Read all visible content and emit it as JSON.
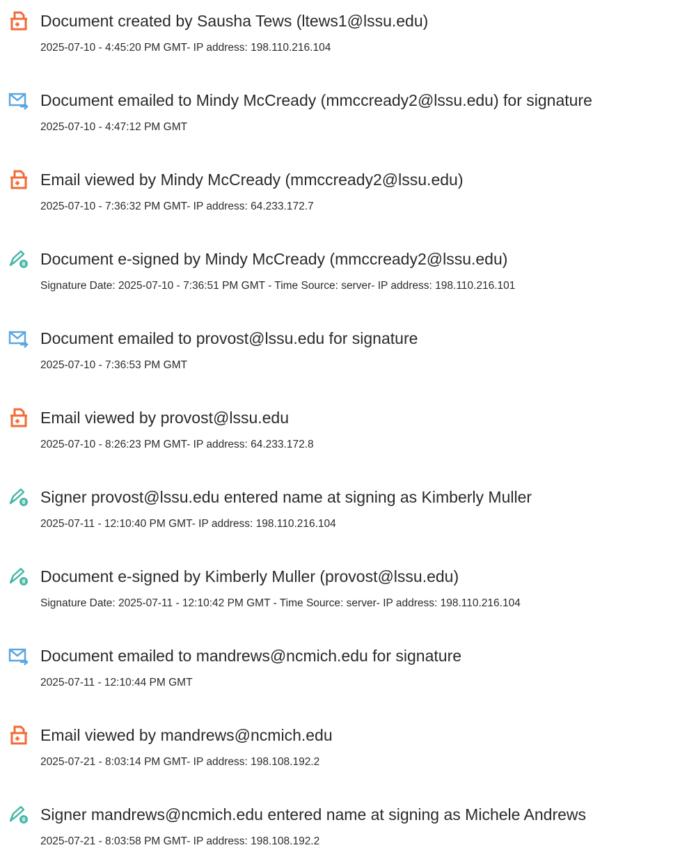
{
  "events": [
    {
      "icon": "document-created-icon",
      "title": "Document created by Sausha Tews (ltews1@lssu.edu)",
      "detail": "2025-07-10 - 4:45:20 PM GMT- IP address: 198.110.216.104"
    },
    {
      "icon": "document-emailed-icon",
      "title": "Document emailed to Mindy McCready (mmccready2@lssu.edu) for signature",
      "detail": "2025-07-10 - 4:47:12 PM GMT"
    },
    {
      "icon": "email-viewed-icon",
      "title": "Email viewed by Mindy McCready (mmccready2@lssu.edu)",
      "detail": "2025-07-10 - 7:36:32 PM GMT- IP address: 64.233.172.7"
    },
    {
      "icon": "e-signature-pen-icon",
      "title": "Document e-signed by Mindy McCready (mmccready2@lssu.edu)",
      "detail": "Signature Date: 2025-07-10 - 7:36:51 PM GMT - Time Source: server- IP address: 198.110.216.101"
    },
    {
      "icon": "document-emailed-icon",
      "title": "Document emailed to provost@lssu.edu for signature",
      "detail": "2025-07-10 - 7:36:53 PM GMT"
    },
    {
      "icon": "email-viewed-icon",
      "title": "Email viewed by provost@lssu.edu",
      "detail": "2025-07-10 - 8:26:23 PM GMT- IP address: 64.233.172.8"
    },
    {
      "icon": "e-signature-pen-icon",
      "title": "Signer provost@lssu.edu entered name at signing as Kimberly Muller",
      "detail": "2025-07-11 - 12:10:40 PM GMT- IP address: 198.110.216.104"
    },
    {
      "icon": "e-signature-pen-icon",
      "title": "Document e-signed by Kimberly Muller (provost@lssu.edu)",
      "detail": "Signature Date: 2025-07-11 - 12:10:42 PM GMT - Time Source: server- IP address: 198.110.216.104"
    },
    {
      "icon": "document-emailed-icon",
      "title": "Document emailed to mandrews@ncmich.edu for signature",
      "detail": "2025-07-11 - 12:10:44 PM GMT"
    },
    {
      "icon": "email-viewed-icon",
      "title": "Email viewed by mandrews@ncmich.edu",
      "detail": "2025-07-21 - 8:03:14 PM GMT- IP address: 198.108.192.2"
    },
    {
      "icon": "e-signature-pen-icon",
      "title": "Signer mandrews@ncmich.edu entered name at signing as Michele Andrews",
      "detail": "2025-07-21 - 8:03:58 PM GMT- IP address: 198.108.192.2"
    }
  ],
  "colors": {
    "document_icon": "#f26a37",
    "email_icon": "#5ba7e0",
    "pen_icon": "#47b8a5"
  }
}
